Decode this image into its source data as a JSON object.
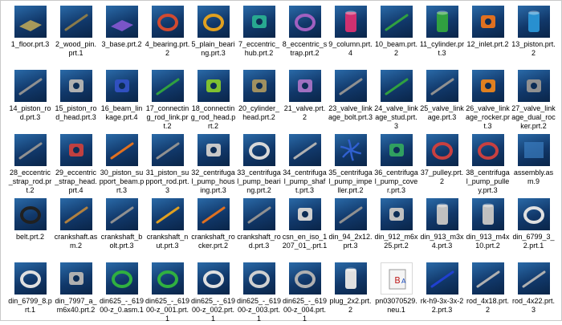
{
  "files": [
    {
      "name": "1_floor.prt.3",
      "icon": "floor-plate-icon",
      "color": "#a89a5a"
    },
    {
      "name": "2_wood_pin.prt.1",
      "icon": "wood-pin-icon",
      "color": "#8a7a4a"
    },
    {
      "name": "3_base.prt.2",
      "icon": "base-bar-icon",
      "color": "#7a55c8"
    },
    {
      "name": "4_bearing.prt.2",
      "icon": "bearing-block-icon",
      "color": "#d24a30"
    },
    {
      "name": "5_plain_bearing.prt.3",
      "icon": "plain-bearing-icon",
      "color": "#e0a020"
    },
    {
      "name": "7_eccentric_hub.prt.2",
      "icon": "eccentric-hub-icon",
      "color": "#28a890"
    },
    {
      "name": "8_eccentric_strap.prt.2",
      "icon": "eccentric-strap-icon",
      "color": "#a060c0"
    },
    {
      "name": "9_column.prt.4",
      "icon": "column-icon",
      "color": "#d03070"
    },
    {
      "name": "10_beam.prt.2",
      "icon": "beam-icon",
      "color": "#30a040"
    },
    {
      "name": "11_cylinder.prt.3",
      "icon": "cylinder-icon",
      "color": "#30a040"
    },
    {
      "name": "12_inlet.prt.2",
      "icon": "inlet-icon",
      "color": "#e07020"
    },
    {
      "name": "13_piston.prt.2",
      "icon": "piston-icon",
      "color": "#2890d0"
    },
    {
      "name": "14_piston_rod.prt.3",
      "icon": "piston-rod-icon",
      "color": "#909090"
    },
    {
      "name": "15_piston_rod_head.prt.3",
      "icon": "piston-rod-head-icon",
      "color": "#b0b0b0"
    },
    {
      "name": "16_beam_linkage.prt.4",
      "icon": "beam-linkage-icon",
      "color": "#3050c0"
    },
    {
      "name": "17_connecting_rod_link.prt.2",
      "icon": "connecting-rod-link-icon",
      "color": "#30a040"
    },
    {
      "name": "18_connecting_rod_head.prt.2",
      "icon": "connecting-rod-head-icon",
      "color": "#80c030"
    },
    {
      "name": "20_cylinder_head.prt.2",
      "icon": "cylinder-head-icon",
      "color": "#a09060"
    },
    {
      "name": "21_valve.prt.2",
      "icon": "valve-icon",
      "color": "#a070c0"
    },
    {
      "name": "23_valve_linkage_bolt.prt.3",
      "icon": "valve-linkage-bolt-icon",
      "color": "#909090"
    },
    {
      "name": "24_valve_linkage_stud.prt.3",
      "icon": "valve-linkage-stud-icon",
      "color": "#30a040"
    },
    {
      "name": "25_valve_linkage.prt.3",
      "icon": "valve-linkage-icon",
      "color": "#909090"
    },
    {
      "name": "26_valve_linkage_rocker.prt.3",
      "icon": "valve-linkage-rocker-icon",
      "color": "#e08020"
    },
    {
      "name": "27_valve_linkage_dual_rocker.prt.2",
      "icon": "valve-linkage-dual-rocker-icon",
      "color": "#909090"
    },
    {
      "name": "28_eccentric_strap_rod.prt.2",
      "icon": "eccentric-strap-rod-icon",
      "color": "#909090"
    },
    {
      "name": "29_eccentric_strap_head.prt.4",
      "icon": "eccentric-strap-head-icon",
      "color": "#c04040"
    },
    {
      "name": "30_piston_support_beam.prt.3",
      "icon": "piston-support-beam-icon",
      "color": "#e07020"
    },
    {
      "name": "31_piston_support_rod.prt.3",
      "icon": "piston-support-rod-icon",
      "color": "#909090"
    },
    {
      "name": "32_centrifugal_pump_housing.prt.3",
      "icon": "pump-housing-icon",
      "color": "#c8c8c8"
    },
    {
      "name": "33_centrifugal_pump_bearing.prt.2",
      "icon": "pump-bearing-icon",
      "color": "#d8d8d8"
    },
    {
      "name": "34_centrifugal_pump_shaft.prt.3",
      "icon": "pump-shaft-icon",
      "color": "#b0b0b0"
    },
    {
      "name": "35_centrifugal_pump_impeller.prt.2",
      "icon": "pump-impeller-icon",
      "color": "#3060d0"
    },
    {
      "name": "36_centrifugal_pump_cover.prt.3",
      "icon": "pump-cover-icon",
      "color": "#30a060"
    },
    {
      "name": "37_pulley.prt.2",
      "icon": "pulley-icon",
      "color": "#c84040"
    },
    {
      "name": "38_centrifugal_pump_pulley.prt.3",
      "icon": "pump-pulley-icon",
      "color": "#c84040"
    },
    {
      "name": "assembly.asm.9",
      "icon": "assembly-icon",
      "color": "#2a6aa8"
    },
    {
      "name": "belt.prt.2",
      "icon": "belt-icon",
      "color": "#202020"
    },
    {
      "name": "crankshaft.asm.2",
      "icon": "crankshaft-assembly-icon",
      "color": "#b08040"
    },
    {
      "name": "crankshaft_bolt.prt.3",
      "icon": "crankshaft-bolt-icon",
      "color": "#909090"
    },
    {
      "name": "crankshaft_nut.prt.3",
      "icon": "crankshaft-nut-icon",
      "color": "#e0a020"
    },
    {
      "name": "crankshaft_rocker.prt.2",
      "icon": "crankshaft-rocker-icon",
      "color": "#e07020"
    },
    {
      "name": "crankshaft_rod.prt.3",
      "icon": "crankshaft-rod-icon",
      "color": "#909090"
    },
    {
      "name": "csn_en_iso_1207_01_.prt.1",
      "icon": "screw-icon",
      "color": "#d0d0d0"
    },
    {
      "name": "din_94_2x12.prt.3",
      "icon": "split-pin-icon",
      "color": "#909090"
    },
    {
      "name": "din_912_m6x25.prt.2",
      "icon": "socket-screw-icon",
      "color": "#c0c0c0"
    },
    {
      "name": "din_913_m3x4.prt.3",
      "icon": "set-screw-icon",
      "color": "#c0c0c0"
    },
    {
      "name": "din_913_m4x10.prt.2",
      "icon": "set-screw-long-icon",
      "color": "#c0c0c0"
    },
    {
      "name": "din_6799_3_2.prt.1",
      "icon": "retaining-washer-icon",
      "color": "#e0e0e0"
    },
    {
      "name": "din_6799_8.prt.1",
      "icon": "retaining-ring-icon",
      "color": "#e0e0e0"
    },
    {
      "name": "din_7997_a_m6x40.prt.2",
      "icon": "wood-screw-icon",
      "color": "#b0b0b0"
    },
    {
      "name": "din625_-_61900-z_0.asm.1",
      "icon": "ball-bearing-assembly-icon",
      "color": "#30b040"
    },
    {
      "name": "din625_-_61900-z_001.prt.1",
      "icon": "bearing-ring-icon",
      "color": "#30b040"
    },
    {
      "name": "din625_-_61900-z_002.prt.1",
      "icon": "bearing-balls-icon",
      "color": "#e0e0e0"
    },
    {
      "name": "din625_-_61900-z_003.prt.1",
      "icon": "bearing-cage-icon",
      "color": "#d0d0d0"
    },
    {
      "name": "din625_-_61900-z_004.prt.1",
      "icon": "bearing-shield-icon",
      "color": "#b0b0b0"
    },
    {
      "name": "plug_2x2.prt.2",
      "icon": "plug-icon",
      "color": "#e0e0e0"
    },
    {
      "name": "pn03070529.neu.1",
      "icon": "neutral-file-icon",
      "color": "#ffffff"
    },
    {
      "name": "rk-h9-3x-3x-22.prt.3",
      "icon": "key-rod-icon",
      "color": "#2040d0"
    },
    {
      "name": "rod_4x18.prt.2",
      "icon": "short-rod-icon",
      "color": "#b0b0b0"
    },
    {
      "name": "rod_4x22.prt.3",
      "icon": "long-rod-icon",
      "color": "#b0b0b0"
    }
  ]
}
